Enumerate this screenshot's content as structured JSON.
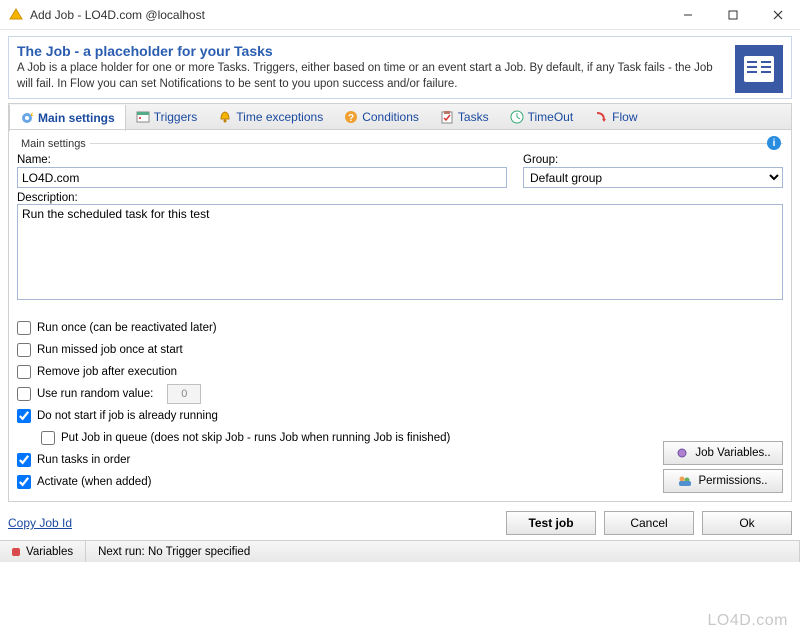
{
  "window": {
    "title": "Add Job - LO4D.com @localhost"
  },
  "header": {
    "title": "The Job - a placeholder for your Tasks",
    "description": "A Job is a place holder for one or more Tasks. Triggers, either based on time or an event start a Job. By default, if any Task fails - the Job will fail. In Flow you can set Notifications to be sent to you upon success and/or failure."
  },
  "tabs": [
    {
      "label": "Main settings",
      "icon": "gear-star-icon",
      "active": true
    },
    {
      "label": "Triggers",
      "icon": "calendar-icon",
      "active": false
    },
    {
      "label": "Time exceptions",
      "icon": "bell-icon",
      "active": false
    },
    {
      "label": "Conditions",
      "icon": "question-icon",
      "active": false
    },
    {
      "label": "Tasks",
      "icon": "clipboard-icon",
      "active": false
    },
    {
      "label": "TimeOut",
      "icon": "clock-icon",
      "active": false
    },
    {
      "label": "Flow",
      "icon": "flow-icon",
      "active": false
    }
  ],
  "main": {
    "fieldset_title": "Main settings",
    "name_label": "Name:",
    "name_value": "LO4D.com",
    "group_label": "Group:",
    "group_value": "Default group",
    "description_label": "Description:",
    "description_value": "Run the scheduled task for this test",
    "checks": {
      "run_once": {
        "label": "Run once (can be reactivated later)",
        "checked": false
      },
      "run_missed": {
        "label": "Run missed job once at start",
        "checked": false
      },
      "remove_after": {
        "label": "Remove job after execution",
        "checked": false
      },
      "use_random": {
        "label": "Use run random value:",
        "checked": false,
        "value": "0"
      },
      "no_start_if_running": {
        "label": "Do not start if job is already running",
        "checked": true
      },
      "put_in_queue": {
        "label": "Put Job in queue (does not skip Job - runs Job when running Job is finished)",
        "checked": false
      },
      "run_in_order": {
        "label": "Run tasks in order",
        "checked": true
      },
      "activate": {
        "label": "Activate (when added)",
        "checked": true
      }
    },
    "side_buttons": {
      "job_variables": "Job Variables..",
      "permissions": "Permissions.."
    }
  },
  "footer": {
    "copy_link": "Copy Job Id",
    "test": "Test job",
    "cancel": "Cancel",
    "ok": "Ok"
  },
  "status": {
    "variables": "Variables",
    "next_run": "Next run: No Trigger specified"
  },
  "watermark": "LO4D.com"
}
